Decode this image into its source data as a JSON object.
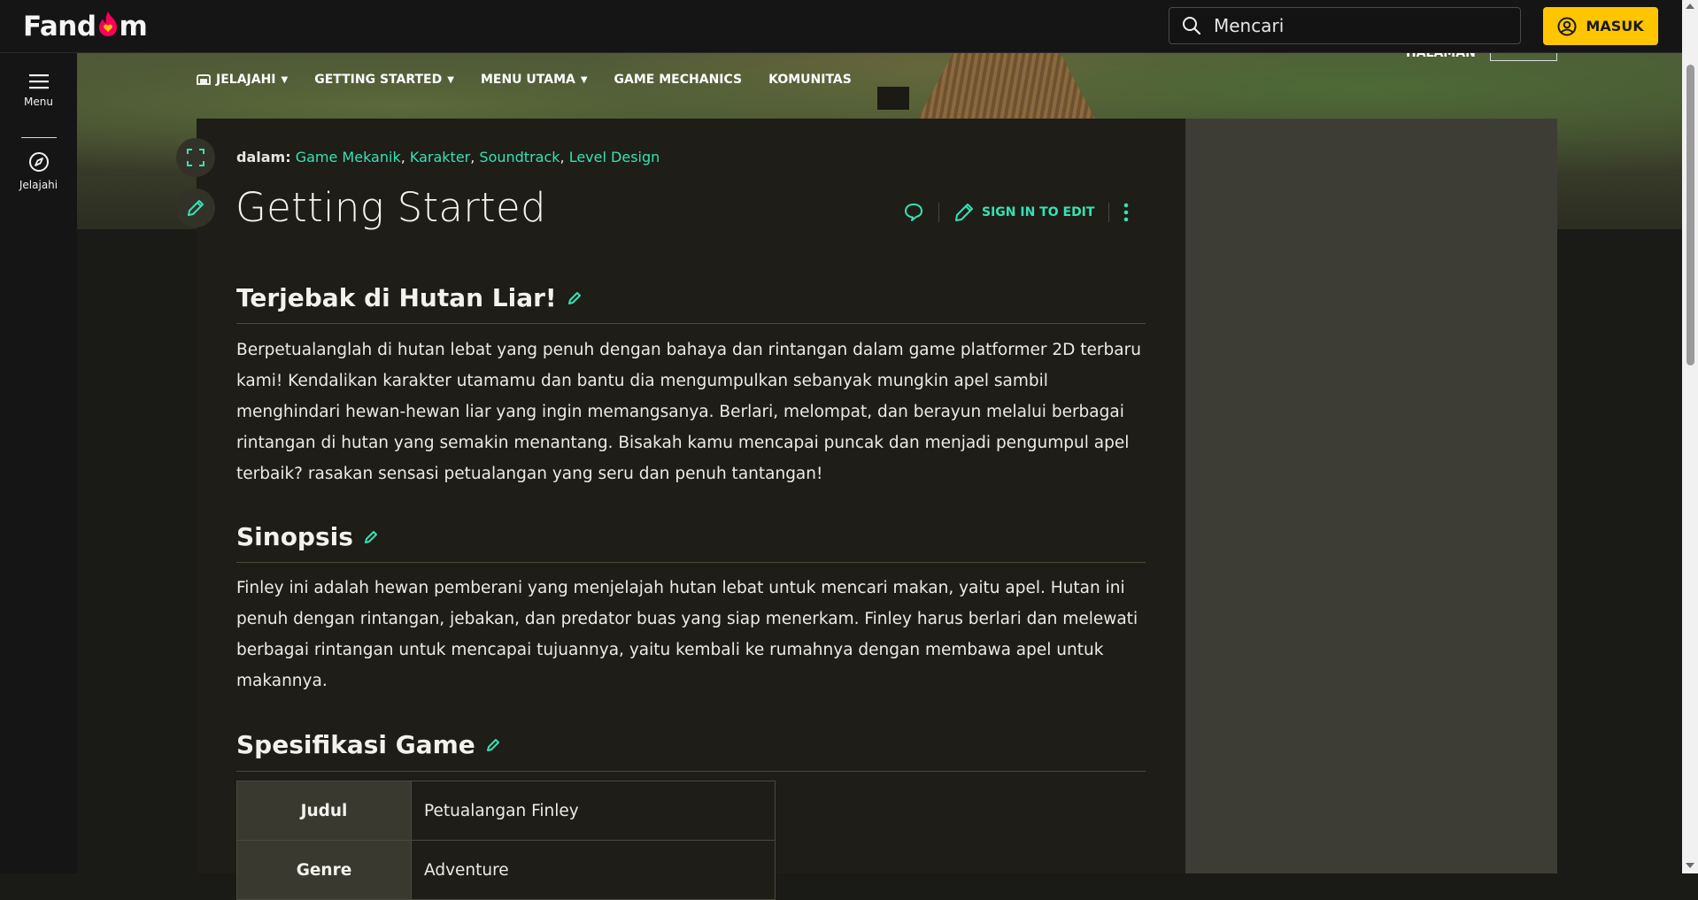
{
  "brand": {
    "logo_text_a": "Fand",
    "logo_text_b": "m"
  },
  "search": {
    "placeholder": "Mencari"
  },
  "login_label": "MASUK",
  "rail": {
    "menu_label": "Menu",
    "explore_label": "Jelajahi"
  },
  "nav": {
    "items": [
      {
        "label": "JELAJAHI",
        "has_dropdown": true
      },
      {
        "label": "GETTING STARTED",
        "has_dropdown": true
      },
      {
        "label": "MENU UTAMA",
        "has_dropdown": true
      },
      {
        "label": "GAME MECHANICS",
        "has_dropdown": false
      },
      {
        "label": "KOMUNITAS",
        "has_dropdown": false
      }
    ]
  },
  "header_corner_label": "HALAMAN",
  "categories": {
    "prefix": "dalam:",
    "items": [
      "Game Mekanik",
      "Karakter",
      "Soundtrack",
      "Level Design"
    ]
  },
  "page_title": "Getting Started",
  "actions": {
    "sign_in_edit": "SIGN IN TO EDIT"
  },
  "sections": [
    {
      "heading": "Terjebak di Hutan Liar!",
      "text": "Berpetualanglah di hutan lebat yang penuh dengan bahaya dan rintangan dalam game platformer 2D terbaru kami! Kendalikan karakter utamamu dan bantu dia mengumpulkan sebanyak mungkin apel sambil menghindari hewan-hewan liar yang ingin memangsanya. Berlari, melompat, dan berayun melalui berbagai rintangan di hutan yang semakin menantang. Bisakah kamu mencapai puncak dan menjadi pengumpul apel terbaik? rasakan sensasi petualangan yang seru dan penuh tantangan!"
    },
    {
      "heading": "Sinopsis",
      "text": "Finley ini adalah hewan pemberani yang menjelajah hutan lebat untuk mencari makan, yaitu apel. Hutan ini penuh dengan rintangan, jebakan, dan predator buas yang siap menerkam. Finley harus berlari dan melewati berbagai rintangan untuk mencapai tujuannya, yaitu kembali ke rumahnya dengan membawa apel untuk makannya."
    },
    {
      "heading": "Spesifikasi Game",
      "table": [
        {
          "key": "Judul",
          "value": "Petualangan Finley"
        },
        {
          "key": "Genre",
          "value": "Adventure"
        }
      ]
    }
  ],
  "colors": {
    "accent": "#34e3b4",
    "login_bg": "#ffc500",
    "brand_flame": "#fa005a"
  }
}
